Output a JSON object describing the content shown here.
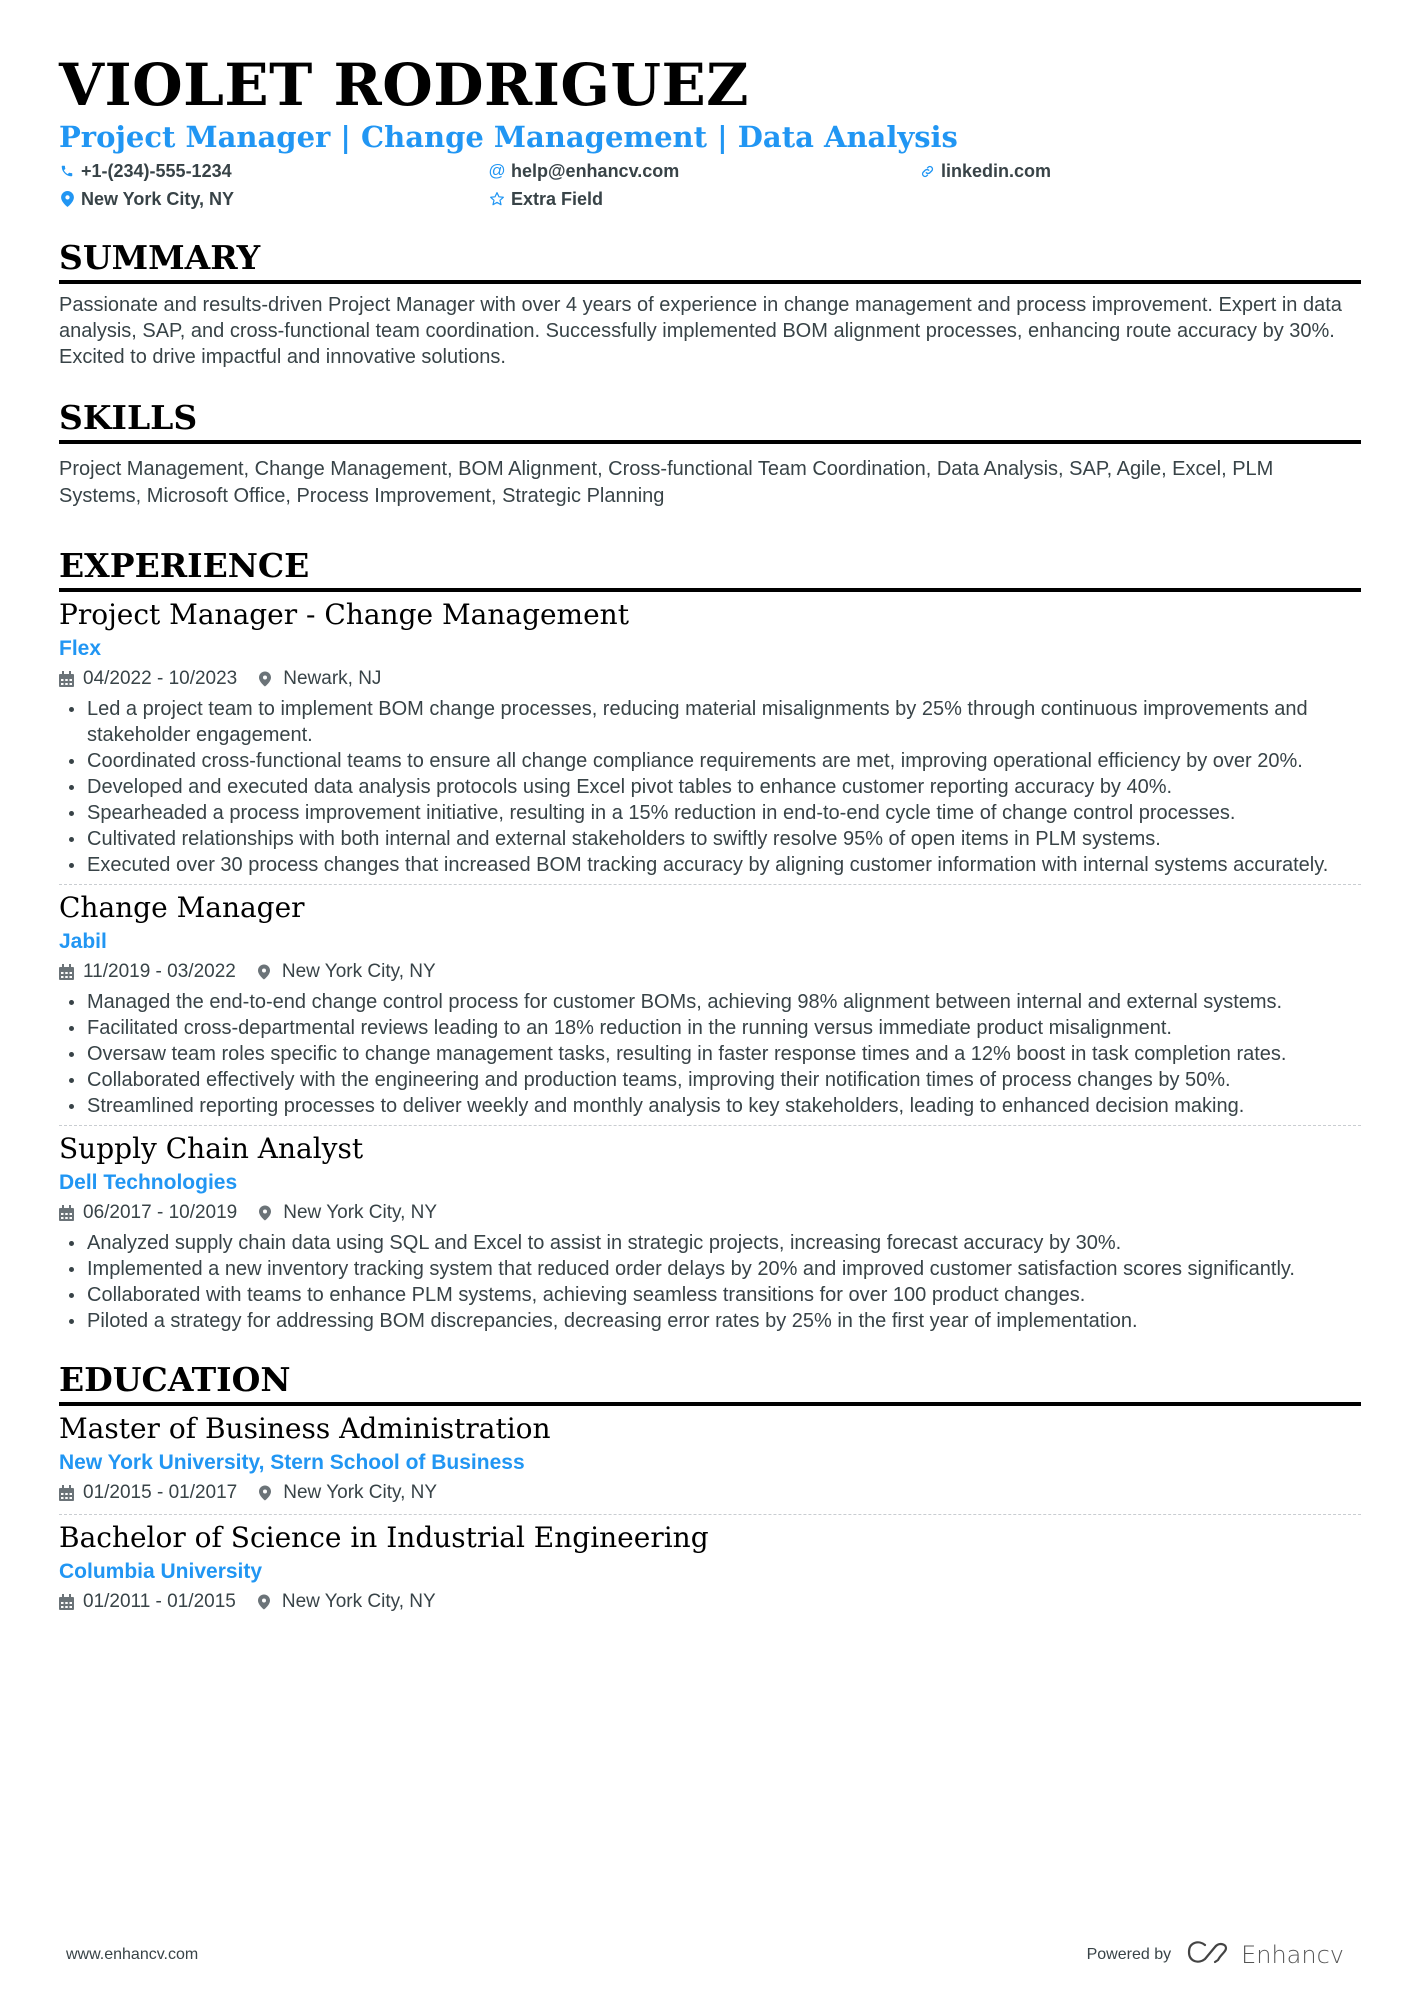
{
  "header": {
    "name": "VIOLET RODRIGUEZ",
    "title": "Project Manager | Change Management | Data Analysis",
    "contacts": [
      {
        "icon": "phone-icon",
        "text": "+1-(234)-555-1234"
      },
      {
        "icon": "at-icon",
        "text": "help@enhancv.com"
      },
      {
        "icon": "link-icon",
        "text": "linkedin.com"
      },
      {
        "icon": "location-pin-icon",
        "text": "New York City, NY"
      },
      {
        "icon": "star-icon",
        "text": "Extra Field"
      }
    ]
  },
  "summary": {
    "heading": "SUMMARY",
    "text": "Passionate and results-driven Project Manager with over 4 years of experience in change management and process improvement. Expert in data analysis, SAP, and cross-functional team coordination. Successfully implemented BOM alignment processes, enhancing route accuracy by 30%. Excited to drive impactful and innovative solutions."
  },
  "skills": {
    "heading": "SKILLS",
    "text": "Project Management, Change Management, BOM Alignment, Cross-functional Team Coordination, Data Analysis, SAP, Agile, Excel, PLM Systems, Microsoft Office, Process Improvement, Strategic Planning"
  },
  "experience": {
    "heading": "EXPERIENCE",
    "items": [
      {
        "title": "Project Manager - Change Management",
        "company": "Flex",
        "dates": "04/2022 - 10/2023",
        "location": "Newark, NJ",
        "bullets": [
          "Led a project team to implement BOM change processes, reducing material misalignments by 25% through continuous improvements and stakeholder engagement.",
          "Coordinated cross-functional teams to ensure all change compliance requirements are met, improving operational efficiency by over 20%.",
          "Developed and executed data analysis protocols using Excel pivot tables to enhance customer reporting accuracy by 40%.",
          "Spearheaded a process improvement initiative, resulting in a 15% reduction in end-to-end cycle time of change control processes.",
          "Cultivated relationships with both internal and external stakeholders to swiftly resolve 95% of open items in PLM systems.",
          "Executed over 30 process changes that increased BOM tracking accuracy by aligning customer information with internal systems accurately."
        ]
      },
      {
        "title": "Change Manager",
        "company": "Jabil",
        "dates": "11/2019 - 03/2022",
        "location": "New York City, NY",
        "bullets": [
          "Managed the end-to-end change control process for customer BOMs, achieving 98% alignment between internal and external systems.",
          "Facilitated cross-departmental reviews leading to an 18% reduction in the running versus immediate product misalignment.",
          "Oversaw team roles specific to change management tasks, resulting in faster response times and a 12% boost in task completion rates.",
          "Collaborated effectively with the engineering and production teams, improving their notification times of process changes by 50%.",
          "Streamlined reporting processes to deliver weekly and monthly analysis to key stakeholders, leading to enhanced decision making."
        ]
      },
      {
        "title": "Supply Chain Analyst",
        "company": "Dell Technologies",
        "dates": "06/2017 - 10/2019",
        "location": "New York City, NY",
        "bullets": [
          "Analyzed supply chain data using SQL and Excel to assist in strategic projects, increasing forecast accuracy by 30%.",
          "Implemented a new inventory tracking system that reduced order delays by 20% and improved customer satisfaction scores significantly.",
          "Collaborated with teams to enhance PLM systems, achieving seamless transitions for over 100 product changes.",
          "Piloted a strategy for addressing BOM discrepancies, decreasing error rates by 25% in the first year of implementation."
        ]
      }
    ]
  },
  "education": {
    "heading": "EDUCATION",
    "items": [
      {
        "degree": "Master of Business Administration",
        "school": "New York University, Stern School of Business",
        "dates": "01/2015 - 01/2017",
        "location": "New York City, NY"
      },
      {
        "degree": "Bachelor of Science in Industrial Engineering",
        "school": "Columbia University",
        "dates": "01/2011 - 01/2015",
        "location": "New York City, NY"
      }
    ]
  },
  "footer": {
    "website": "www.enhancv.com",
    "powered_by": "Powered by",
    "brand": "Enhancv"
  },
  "colors": {
    "accent": "#2196f3",
    "text": "#384347",
    "heading": "#000000"
  }
}
